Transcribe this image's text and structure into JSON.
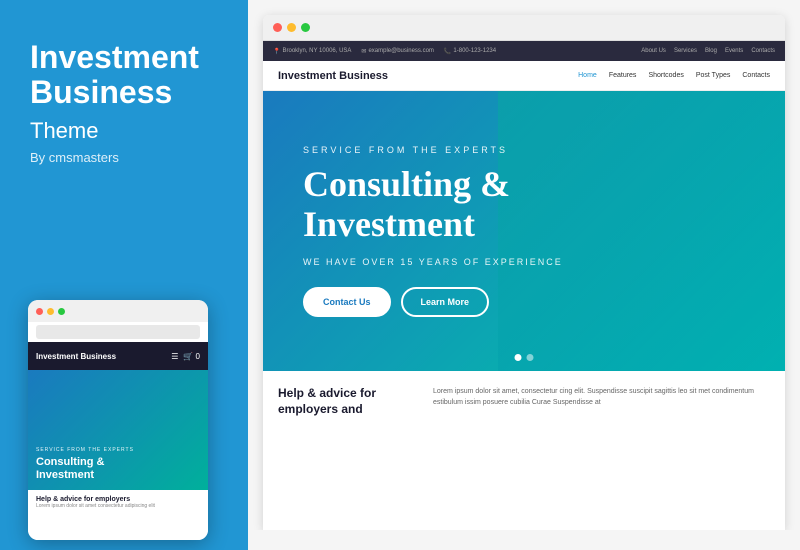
{
  "left": {
    "title": "Investment Business",
    "subtitle": "Theme",
    "author": "By cmsmasters",
    "mobile": {
      "nav_title": "Investment Business",
      "service_label": "SERVICE FROM THE EXPERTS",
      "consulting_text": "Consulting &\nInvestment",
      "bottom_title": "Help & advice for employers",
      "bottom_text": "Lorem ipsum dolor sit amet..."
    }
  },
  "browser": {
    "dots": [
      "red",
      "yellow",
      "green"
    ]
  },
  "website": {
    "topbar": {
      "address": "Brooklyn, NY 10006, USA",
      "email": "example@business.com",
      "phone": "1-800-123-1234",
      "nav_items": [
        "About Us",
        "Services",
        "Blog",
        "Events",
        "Contacts"
      ]
    },
    "navbar": {
      "brand": "Investment Business",
      "links": [
        "Home",
        "Features",
        "Shortcodes",
        "Post Types",
        "Contacts"
      ]
    },
    "hero": {
      "service_label": "SERVICE FROM THE EXPERTS",
      "title_line1": "Consulting &",
      "title_line2": "Investment",
      "subtitle": "WE HAVE OVER 15 YEARS OF EXPERIENCE",
      "btn_contact": "Contact Us",
      "btn_learn": "Learn More"
    },
    "bottom": {
      "left_title": "Help & advice for employers and",
      "right_text": "Lorem ipsum dolor sit amet, consectetur cing elit. Suspendisse suscipit sagittis leo sit met condimentum estibulum issim posuere cubilia Curae Suspendisse at"
    }
  }
}
